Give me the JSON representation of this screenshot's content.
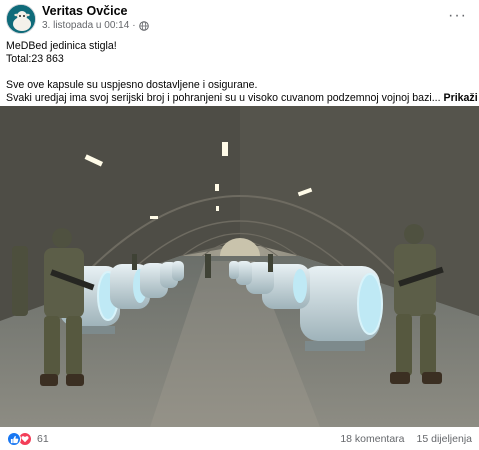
{
  "post": {
    "author": "Veritas Ovčice",
    "timestamp": "3. listopada u 00:14",
    "separator": "·",
    "privacy_icon": "globe-icon",
    "more_icon": "more-options-icon",
    "more_label": "···",
    "lines": {
      "line1": "MeDBed jedinica stigla!",
      "line2": "Total:23 863",
      "line3": "Sve ove kapsule su uspjesno dostavljene i osigurane.",
      "line4": "Svaki uredjaj ima svoj serijski broj i pohranjeni su u visoko cuvanom podzemnoj vojnoj bazi..."
    },
    "see_more": "Prikaži više"
  },
  "footer": {
    "reaction_icons": [
      "like-icon",
      "love-icon"
    ],
    "reaction_count": "61",
    "comments": "18 komentara",
    "shares": "15 dijeljenja"
  },
  "colors": {
    "like": "#1877f2",
    "love": "#f33e58",
    "secondary_text": "#65676b"
  }
}
